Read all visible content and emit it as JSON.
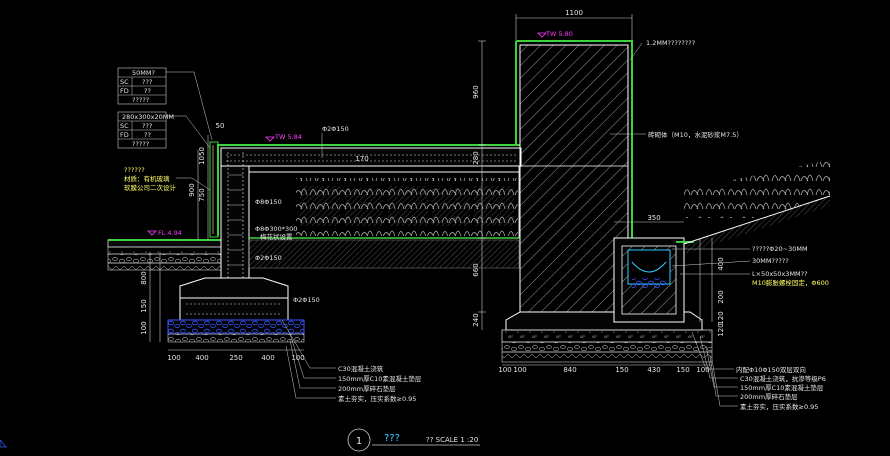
{
  "dimensions": {
    "top_width": "1100",
    "left_50": "50",
    "height_960": "960",
    "height_280": "280",
    "height_660": "660",
    "height_240": "240",
    "height_170": "170",
    "height_1050": "1050",
    "height_900": "900",
    "height_750": "750",
    "height_800": "800",
    "height_150": "150",
    "height_100": "100",
    "right_400": "400",
    "right_200": "200",
    "right_120": "120",
    "right_120b": "120",
    "right_350": "350",
    "bottom_left": [
      "100",
      "400",
      "250",
      "400",
      "100"
    ],
    "bottom_right": [
      "100",
      "100",
      "840",
      "150",
      "430",
      "150",
      "100"
    ]
  },
  "rebar_labels": {
    "r1": "Φ2Φ150",
    "r2": "Φ8Φ150",
    "r3": "Φ8Φ300*300",
    "r3b": "梅花状设置",
    "r4": "Φ2Φ150",
    "r5": "Φ2Φ150"
  },
  "levels": {
    "tw_top": "TW 5.80",
    "tw_mid": "TW 5.84",
    "fl": "FL 4.94"
  },
  "callout_a": {
    "title": "50MM?",
    "row1_key": "SC",
    "row1_val": "???",
    "row2_key": "FD",
    "row2_val": "??",
    "row3": "?????"
  },
  "callout_b": {
    "title": "280x300x20MM",
    "row1_key": "SC",
    "row1_val": "???",
    "row2_key": "FD",
    "row2_val": "??",
    "row3": "?????"
  },
  "left_note": {
    "l1": "??????",
    "l2": "材质：有机玻璃",
    "l3": "软膜公司二次设计"
  },
  "right_notes": {
    "top": "1.2MM????????",
    "wall": "砖砌体（M10，水泥砂浆M7.5）",
    "n1": "?????Φ20~30MM",
    "n2": "30MM?????",
    "n3": "L×50x50x3MM??",
    "n4": "M10膨胀螺栓固定，Φ600"
  },
  "bottom_notes_left": {
    "l1": "C30混凝土浇筑",
    "l2": "150mm厚C10素混凝土垫层",
    "l3": "200mm厚碎石垫层",
    "l4": "素土夯实，压实系数≥0.95"
  },
  "bottom_notes_right": {
    "l0": "内配Φ10Φ150双层双向",
    "l1": "C30混凝土浇筑，抗渗等级P6",
    "l2": "150mm厚C10素混凝土垫层",
    "l3": "200mm厚碎石垫层",
    "l4": "素土夯实，压实系数≥0.95"
  },
  "title_block": {
    "number": "1",
    "name": "???",
    "scale": "?? SCALE 1 :20"
  },
  "colors": {
    "background": "#000000",
    "line": "#ffffff",
    "green": "#3cd23c",
    "magenta": "#ff3cff",
    "cyan": "#33ccff",
    "yellow": "#ffff66",
    "blue": "#3355ff",
    "gray": "#9a9a9a"
  }
}
